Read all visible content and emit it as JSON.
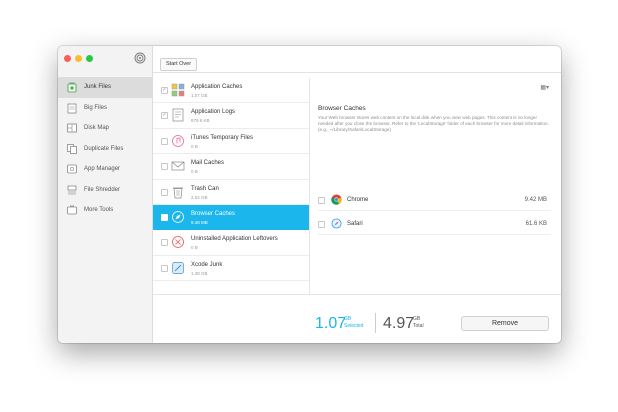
{
  "toolbar": {
    "start_over_label": "Start Over"
  },
  "sidebar": {
    "items": [
      {
        "label": "Junk Files",
        "icon": "junk-files-icon",
        "active": true
      },
      {
        "label": "Big Files",
        "icon": "big-files-icon"
      },
      {
        "label": "Disk Map",
        "icon": "disk-map-icon"
      },
      {
        "label": "Duplicate Files",
        "icon": "duplicate-files-icon"
      },
      {
        "label": "App Manager",
        "icon": "app-manager-icon"
      },
      {
        "label": "File Shredder",
        "icon": "file-shredder-icon"
      },
      {
        "label": "More Tools",
        "icon": "more-tools-icon"
      }
    ]
  },
  "list": {
    "rows": [
      {
        "title": "Application Caches",
        "size": "1.07 GB",
        "checked": true
      },
      {
        "title": "Application Logs",
        "size": "879.6 KB",
        "checked": true
      },
      {
        "title": "iTunes Temporary Files",
        "size": "0 B",
        "checked": false
      },
      {
        "title": "Mail Caches",
        "size": "0 B",
        "checked": false
      },
      {
        "title": "Trash Can",
        "size": "2.52 GB",
        "checked": false
      },
      {
        "title": "Browser Caches",
        "size": "9.48 MB",
        "checked": false,
        "selected": true
      },
      {
        "title": "Uninstalled Application Leftovers",
        "size": "0 B",
        "checked": false
      },
      {
        "title": "Xcode Junk",
        "size": "1.38 GB",
        "checked": false
      }
    ]
  },
  "detail": {
    "view_toggle": "▦▾",
    "title": "Browser Caches",
    "description": "Your Web browser stores web content on the local disk when you view web pages. This content is no longer needed after you close the browser. Refer to the 'LocalStorage' folder of each browser for more detail information. (e.g., ~/Library/Safari/LocalStorage)",
    "browsers": [
      {
        "name": "Chrome",
        "size": "9.42 MB",
        "icon": "chrome-icon"
      },
      {
        "name": "Safari",
        "size": "61.6 KB",
        "icon": "safari-icon"
      }
    ]
  },
  "footer": {
    "selected_value": "1.07",
    "selected_unit": "GB",
    "selected_label": "Selected",
    "total_value": "4.97",
    "total_unit": "GB",
    "total_label": "Total",
    "remove_label": "Remove"
  },
  "colors": {
    "accent": "#1ab6ec"
  }
}
